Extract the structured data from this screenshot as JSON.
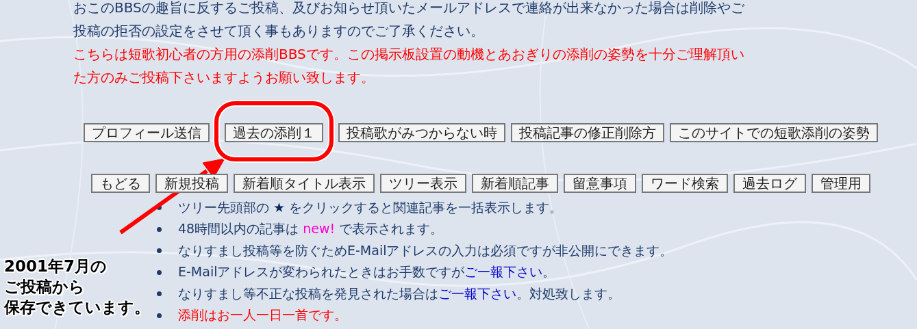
{
  "notice_lines": [
    {
      "text": "おこのBBSの趣旨に反するご投稿、及びお知らせ頂いたメールアドレスで連絡が出来なかった場合は削除やご",
      "kind": "plain"
    },
    {
      "text": "投稿の拒否の設定をさせて頂く事もありますのでご了承ください。",
      "kind": "plain"
    },
    {
      "text": "こちらは短歌初心者の方用の添削BBSです。この掲示板設置の動機とあおぎりの添削の姿勢を十分ご理解頂い",
      "kind": "warning"
    },
    {
      "text": "た方のみご投稿下さいますようお願い致します。",
      "kind": "warning"
    }
  ],
  "nav_rows": [
    [
      {
        "label": "プロフィール送信",
        "circled": false
      },
      {
        "label": "過去の添削１",
        "circled": true
      },
      {
        "label": "投稿歌がみつからない時",
        "circled": false
      },
      {
        "label": "投稿記事の修正削除方",
        "circled": false
      },
      {
        "label": "このサイトでの短歌添削の姿勢",
        "circled": false
      }
    ],
    [
      {
        "label": "もどる",
        "circled": false
      },
      {
        "label": "新規投稿",
        "circled": false
      },
      {
        "label": "新着順タイトル表示",
        "circled": false
      },
      {
        "label": "ツリー表示",
        "circled": false
      },
      {
        "label": "新着順記事",
        "circled": false
      },
      {
        "label": "留意事項",
        "circled": false
      },
      {
        "label": "ワード検索",
        "circled": false
      },
      {
        "label": "過去ログ",
        "circled": false
      },
      {
        "label": "管理用",
        "circled": false
      }
    ]
  ],
  "notes": [
    {
      "kind": "plain",
      "segments": [
        {
          "text": "ツリー先頭部の ",
          "kind": "plain"
        },
        {
          "text": "★",
          "kind": "star"
        },
        {
          "text": " をクリックすると関連記事を一括表示します。",
          "kind": "plain"
        }
      ]
    },
    {
      "kind": "plain",
      "segments": [
        {
          "text": "48時間以内の記事は ",
          "kind": "plain"
        },
        {
          "text": "new!",
          "kind": "new"
        },
        {
          "text": " で表示されます。",
          "kind": "plain"
        }
      ]
    },
    {
      "kind": "plain",
      "segments": [
        {
          "text": "なりすまし投稿等を防ぐためE-Mailアドレスの入力は必須ですが非公開にできます。",
          "kind": "plain"
        }
      ]
    },
    {
      "kind": "plain",
      "segments": [
        {
          "text": "E-Mailアドレスが変わられたときはお手数ですが",
          "kind": "plain"
        },
        {
          "text": "ご一報下さい",
          "kind": "link"
        },
        {
          "text": "。",
          "kind": "plain"
        }
      ]
    },
    {
      "kind": "plain",
      "segments": [
        {
          "text": "なりすまし等不正な投稿を発見された場合は",
          "kind": "plain"
        },
        {
          "text": "ご一報下さい",
          "kind": "link"
        },
        {
          "text": "。対処致します。",
          "kind": "plain"
        }
      ]
    },
    {
      "kind": "warning",
      "segments": [
        {
          "text": "添削はお一人一日一首です。",
          "kind": "plain"
        }
      ]
    }
  ],
  "caption_lines": [
    "2001年7月の",
    "ご投稿から",
    "保存できています。"
  ]
}
